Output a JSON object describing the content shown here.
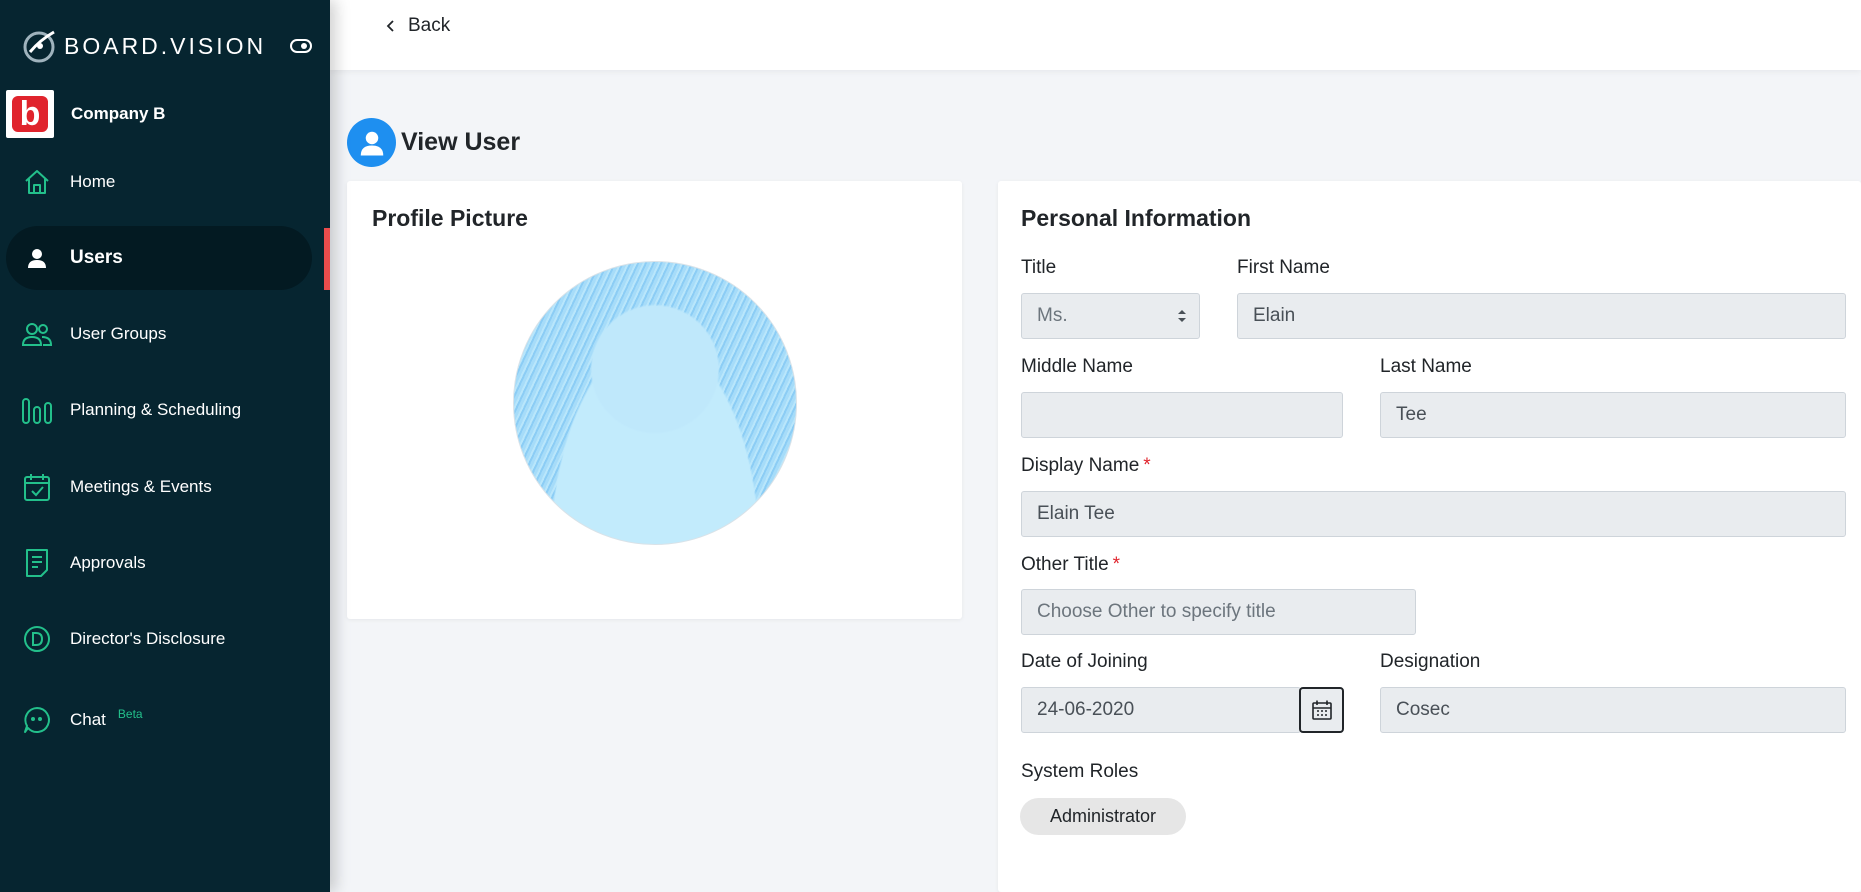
{
  "brand": {
    "name": "BOARD.VISION"
  },
  "company": {
    "name": "Company B",
    "logo_letter": "b"
  },
  "nav": {
    "items": [
      {
        "label": "Home",
        "icon": "home-icon"
      },
      {
        "label": "Users",
        "icon": "user-icon",
        "active": true
      },
      {
        "label": "User Groups",
        "icon": "user-groups-icon"
      },
      {
        "label": "Planning & Scheduling",
        "icon": "bar-chart-icon"
      },
      {
        "label": "Meetings & Events",
        "icon": "calendar-check-icon"
      },
      {
        "label": "Approvals",
        "icon": "document-icon"
      },
      {
        "label": "Director's Disclosure",
        "icon": "circle-d-icon"
      },
      {
        "label": "Chat",
        "icon": "chat-icon",
        "badge": "Beta"
      }
    ]
  },
  "topbar": {
    "back_label": "Back"
  },
  "page": {
    "title": "View User"
  },
  "profile_card": {
    "title": "Profile Picture"
  },
  "personal_card": {
    "title": "Personal Information",
    "fields": {
      "title": {
        "label": "Title",
        "value": "Ms."
      },
      "first_name": {
        "label": "First Name",
        "value": "Elain"
      },
      "middle_name": {
        "label": "Middle Name",
        "value": ""
      },
      "last_name": {
        "label": "Last Name",
        "value": "Tee"
      },
      "display_name": {
        "label": "Display Name",
        "required_mark": "*",
        "value": "Elain Tee"
      },
      "other_title": {
        "label": "Other Title",
        "required_mark": "*",
        "placeholder": "Choose Other to specify title"
      },
      "date_of_joining": {
        "label": "Date of Joining",
        "value": "24-06-2020"
      },
      "designation": {
        "label": "Designation",
        "value": "Cosec"
      }
    },
    "system_roles": {
      "label": "System Roles",
      "roles": [
        "Administrator"
      ]
    }
  },
  "colors": {
    "sidebar_bg": "#062530",
    "accent_green": "#23c08b",
    "active_marker": "#ea4c4c",
    "avatar_blue": "#1e8ff0"
  }
}
